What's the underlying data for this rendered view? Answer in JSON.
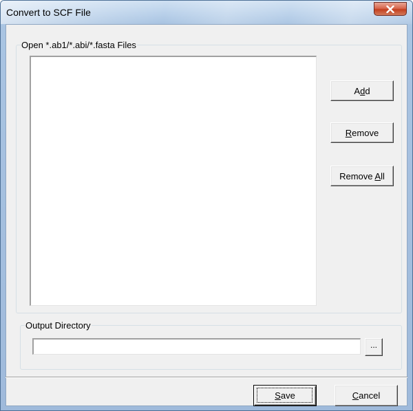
{
  "window": {
    "title": "Convert to SCF File",
    "close_glyph": "×"
  },
  "files_group": {
    "label": "Open *.ab1/*.abi/*.fasta Files",
    "items": []
  },
  "buttons": {
    "add": {
      "pre": "A",
      "key": "d",
      "post": "d"
    },
    "remove": {
      "pre": "",
      "key": "R",
      "post": "emove"
    },
    "remove_all": {
      "pre": "Remove ",
      "key": "A",
      "post": "ll"
    },
    "browse": {
      "label": "..."
    },
    "save": {
      "pre": "",
      "key": "S",
      "post": "ave"
    },
    "cancel": {
      "pre": "",
      "key": "C",
      "post": "ancel"
    }
  },
  "output_group": {
    "label": "Output Directory",
    "path_value": ""
  },
  "icons": {
    "close": "close-x-icon"
  },
  "colors": {
    "close_button": "#c3401f",
    "dialog_face": "#f0f0f0",
    "title_bar": "#b9d1ea"
  }
}
